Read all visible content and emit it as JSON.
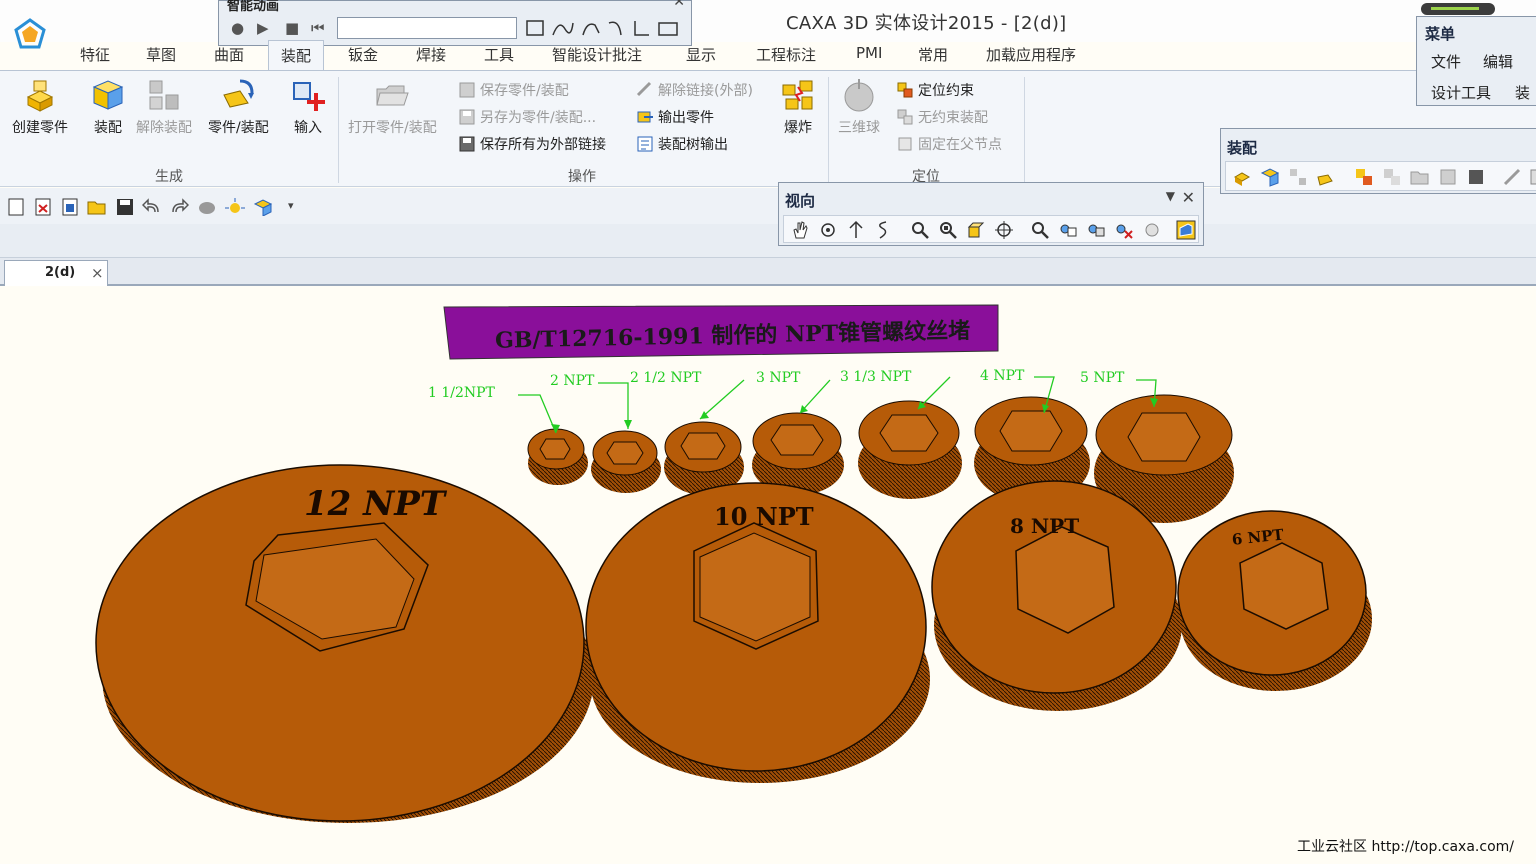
{
  "window": {
    "title": "CAXA 3D 实体设计2015 - [2(d)]"
  },
  "ribbon_tabs": [
    "特征",
    "草图",
    "曲面",
    "装配",
    "钣金",
    "焊接",
    "工具",
    "智能设计批注",
    "显示",
    "工程标注",
    "PMI",
    "常用",
    "加载应用程序"
  ],
  "ribbon": {
    "generate": {
      "label": "生成",
      "buttons": [
        "创建零件",
        "装配",
        "解除装配",
        "零件/装配",
        "输入"
      ]
    },
    "operate": {
      "label": "操作",
      "open": "打开零件/装配",
      "small": [
        "保存零件/装配",
        "另存为零件/装配...",
        "保存所有为外部链接",
        "解除链接(外部)",
        "输出零件",
        "装配树输出"
      ],
      "explode": "爆炸"
    },
    "locate": {
      "label": "定位",
      "ball": "三维球",
      "small": [
        "定位约束",
        "无约束装配",
        "固定在父节点"
      ]
    }
  },
  "panels": {
    "animation": {
      "title": "智能动画"
    },
    "view": {
      "title": "视向"
    },
    "menu": {
      "title": "菜单",
      "items": [
        "文件",
        "编辑",
        "设计工具",
        "装"
      ]
    },
    "assembly": {
      "title": "装配"
    }
  },
  "document_tab": {
    "label": "2(d)",
    "close": "×"
  },
  "scene": {
    "banner": "GB/T12716-1991  制作的 NPT锥管螺纹丝堵",
    "small_labels": [
      "1 1/2NPT",
      "2 NPT",
      "2 1/2 NPT",
      "3 NPT",
      "3 1/3 NPT",
      "4 NPT",
      "5 NPT"
    ],
    "big_labels": [
      "12  NPT",
      "10  NPT",
      "8  NPT",
      "6  NPT"
    ],
    "plug_color": "#b65b08",
    "leader_color": "#22cc22",
    "banner_color": "#8a0f9a"
  },
  "footer": {
    "credit": "工业云社区 http://top.caxa.com/"
  }
}
